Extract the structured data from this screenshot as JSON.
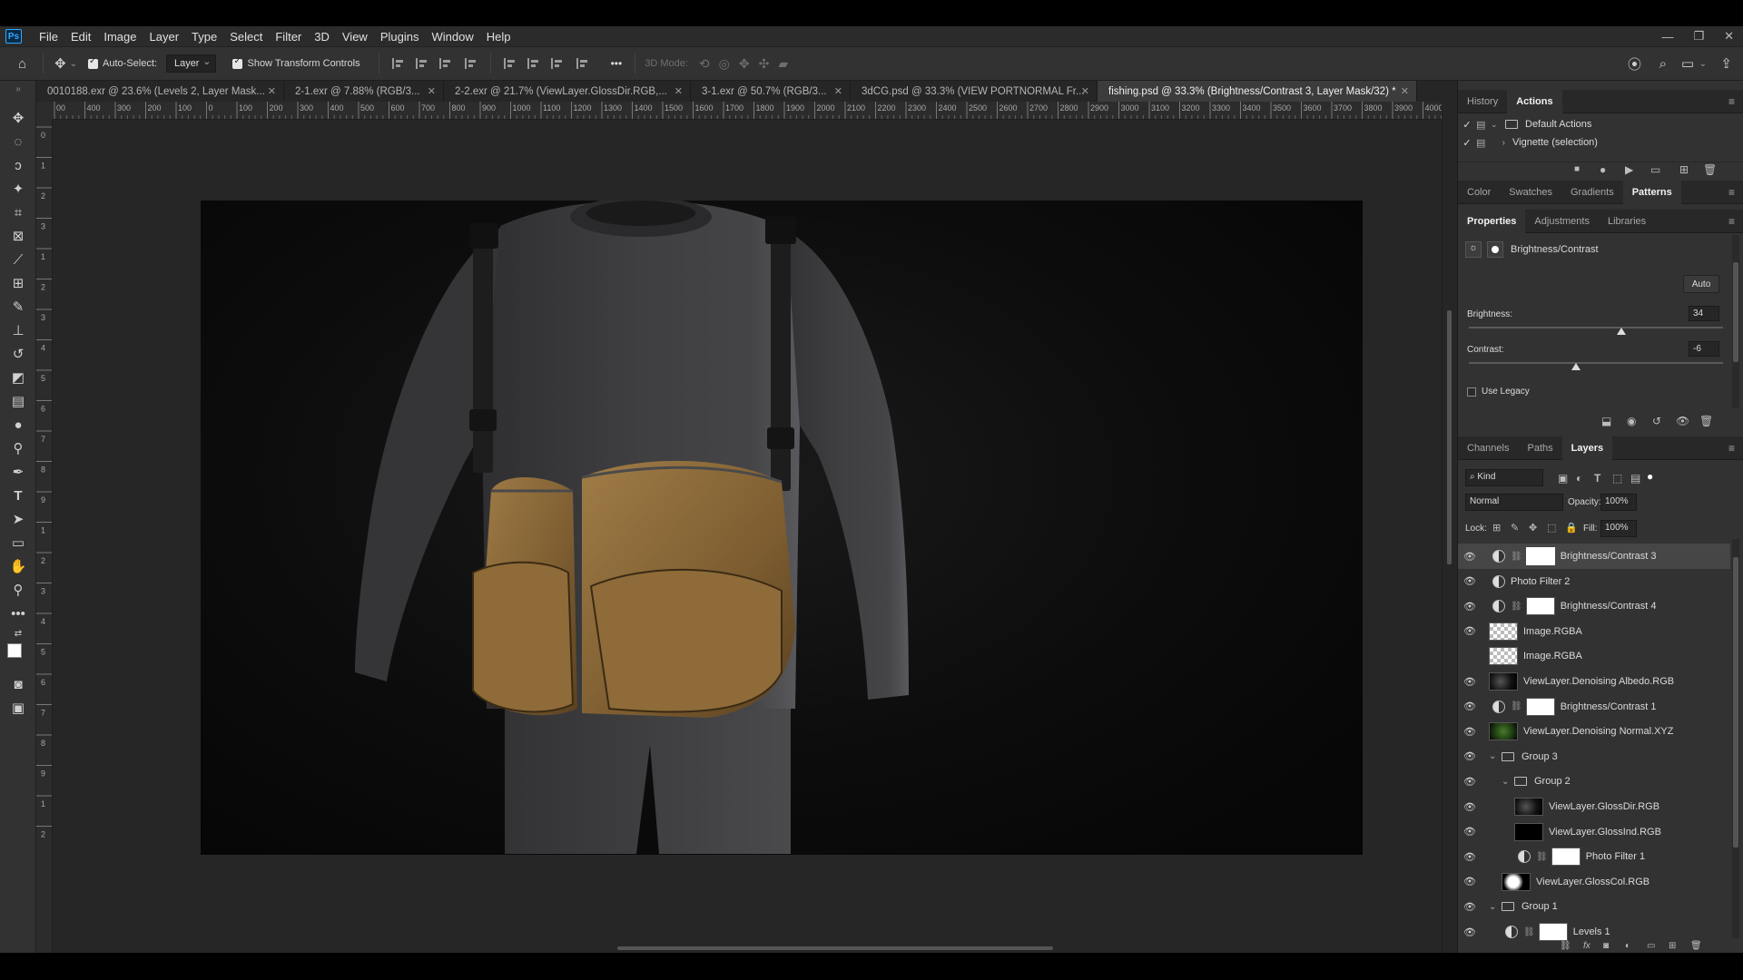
{
  "app": {
    "name": "Ps"
  },
  "menu": [
    "File",
    "Edit",
    "Image",
    "Layer",
    "Type",
    "Select",
    "Filter",
    "3D",
    "View",
    "Plugins",
    "Window",
    "Help"
  ],
  "window_controls": {
    "minimize": "—",
    "restore": "❐",
    "close": "✕"
  },
  "options_bar": {
    "auto_select_label": "Auto-Select:",
    "auto_select_target": "Layer",
    "show_transform_label": "Show Transform Controls",
    "mode_3d_label": "3D Mode:",
    "more": "•••"
  },
  "tabs": [
    {
      "label": "0010188.exr @ 23.6% (Levels 2, Layer Mask...",
      "active": false
    },
    {
      "label": "2-1.exr @ 7.88% (RGB/3...",
      "active": false
    },
    {
      "label": "2-2.exr @ 21.7% (ViewLayer.GlossDir.RGB,...",
      "active": false
    },
    {
      "label": "3-1.exr @ 50.7% (RGB/3...",
      "active": false
    },
    {
      "label": "3dCG.psd @ 33.3% (VIEW PORTNORMAL Fr...",
      "active": false
    },
    {
      "label": "fishing.psd @ 33.3% (Brightness/Contrast 3, Layer Mask/32) *",
      "active": true
    }
  ],
  "ruler": {
    "h_ticks": [
      "00",
      "400",
      "300",
      "200",
      "100",
      "0",
      "100",
      "200",
      "300",
      "400",
      "500",
      "600",
      "700",
      "800",
      "900",
      "1000",
      "1100",
      "1200",
      "1300",
      "1400",
      "1500",
      "1600",
      "1700",
      "1800",
      "1900",
      "2000",
      "2100",
      "2200",
      "2300",
      "2400",
      "2500",
      "2600",
      "2700",
      "2800",
      "2900",
      "3000",
      "3100",
      "3200",
      "3300",
      "3400",
      "3500",
      "3600",
      "3700",
      "3800",
      "3900",
      "4000"
    ],
    "v_ticks": [
      "0",
      "1",
      "2",
      "3",
      "1",
      "2",
      "3",
      "4",
      "5",
      "6",
      "7",
      "8",
      "9",
      "1",
      "2",
      "3",
      "4",
      "5",
      "6",
      "7",
      "8",
      "9",
      "1",
      "2"
    ]
  },
  "history_panel": {
    "tabs": [
      "History",
      "Actions"
    ],
    "active": "Actions",
    "items": [
      {
        "label": "Default Actions",
        "type": "set"
      },
      {
        "label": "Vignette (selection)",
        "type": "action"
      }
    ]
  },
  "color_panel": {
    "tabs": [
      "Color",
      "Swatches",
      "Gradients",
      "Patterns"
    ],
    "active": "Patterns"
  },
  "properties_panel": {
    "tabs": [
      "Properties",
      "Adjustments",
      "Libraries"
    ],
    "active": "Properties",
    "title": "Brightness/Contrast",
    "auto_label": "Auto",
    "brightness_label": "Brightness:",
    "brightness_value": "34",
    "brightness_level": 0.6,
    "contrast_label": "Contrast:",
    "contrast_value": "-6",
    "contrast_level": 0.42,
    "use_legacy_label": "Use Legacy"
  },
  "layers_panel": {
    "tabs": [
      "Channels",
      "Paths",
      "Layers"
    ],
    "active": "Layers",
    "filter_kind": "Kind",
    "blend_mode": "Normal",
    "opacity_label": "Opacity:",
    "opacity_value": "100%",
    "lock_label": "Lock:",
    "fill_label": "Fill:",
    "fill_value": "100%",
    "layers": [
      {
        "name": "Brightness/Contrast 3",
        "kind": "adjustment",
        "thumb": "white",
        "visible": true,
        "selected": true,
        "indent": 0
      },
      {
        "name": "Photo Filter 2",
        "kind": "adjustment-nomask",
        "thumb": "",
        "visible": true,
        "selected": false,
        "indent": 0
      },
      {
        "name": "Brightness/Contrast 4",
        "kind": "adjustment",
        "thumb": "white",
        "visible": true,
        "selected": false,
        "indent": 0
      },
      {
        "name": "Image.RGBA",
        "kind": "pixel",
        "thumb": "checker",
        "visible": true,
        "selected": false,
        "indent": 0
      },
      {
        "name": "Image.RGBA",
        "kind": "pixel",
        "thumb": "checker",
        "visible": false,
        "selected": false,
        "indent": 0
      },
      {
        "name": "ViewLayer.Denoising Albedo.RGB",
        "kind": "pixel",
        "thumb": "dark",
        "visible": true,
        "selected": false,
        "indent": 0
      },
      {
        "name": "Brightness/Contrast 1",
        "kind": "adjustment",
        "thumb": "white",
        "visible": true,
        "selected": false,
        "indent": 0
      },
      {
        "name": "ViewLayer.Denoising Normal.XYZ",
        "kind": "pixel",
        "thumb": "green",
        "visible": true,
        "selected": false,
        "indent": 0
      },
      {
        "name": "Group 3",
        "kind": "group",
        "thumb": "",
        "visible": true,
        "selected": false,
        "indent": 0
      },
      {
        "name": "Group 2",
        "kind": "group",
        "thumb": "",
        "visible": true,
        "selected": false,
        "indent": 1
      },
      {
        "name": "ViewLayer.GlossDir.RGB",
        "kind": "pixel",
        "thumb": "dark",
        "visible": true,
        "selected": false,
        "indent": 2
      },
      {
        "name": "ViewLayer.GlossInd.RGB",
        "kind": "pixel",
        "thumb": "black",
        "visible": true,
        "selected": false,
        "indent": 2
      },
      {
        "name": "Photo Filter 1",
        "kind": "adjustment",
        "thumb": "white",
        "visible": true,
        "selected": false,
        "indent": 2
      },
      {
        "name": "ViewLayer.GlossCol.RGB",
        "kind": "pixel",
        "thumb": "gloss",
        "visible": true,
        "selected": false,
        "indent": 1
      },
      {
        "name": "Group 1",
        "kind": "group",
        "thumb": "",
        "visible": true,
        "selected": false,
        "indent": 0
      },
      {
        "name": "Levels 1",
        "kind": "adjustment",
        "thumb": "white",
        "visible": true,
        "selected": false,
        "indent": 1
      }
    ]
  },
  "colors": {
    "canvas_bg": "#262626",
    "panel_bg": "#323232",
    "shirt": "#3c3c3e",
    "bag": "#8a6a3a",
    "ps_blue": "#31a8ff"
  }
}
